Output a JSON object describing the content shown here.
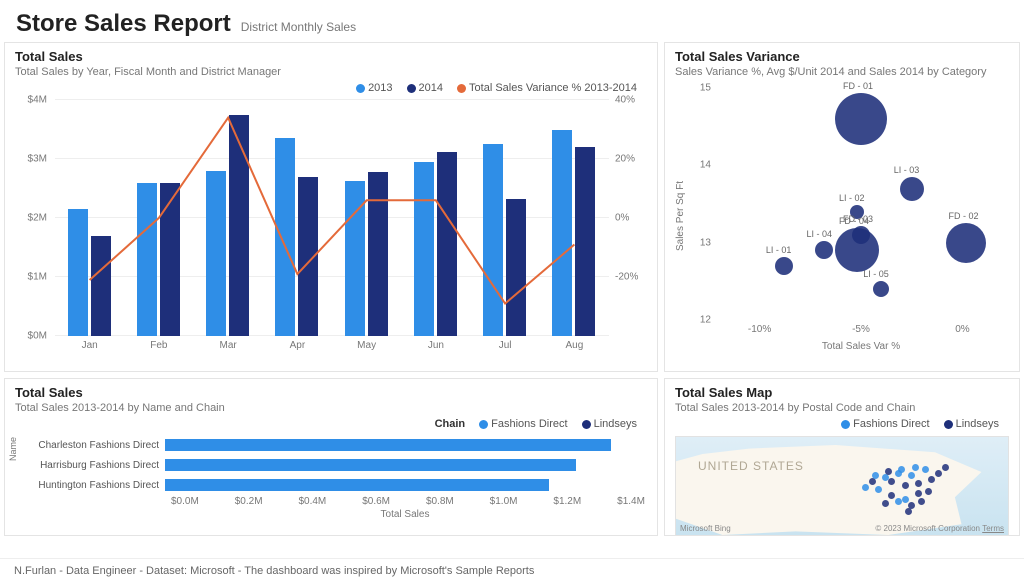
{
  "colors": {
    "blue": "#2f8ee7",
    "navy": "#1e2f7a",
    "orange": "#e46a3a"
  },
  "header": {
    "title": "Store Sales Report",
    "subtitle": "District Monthly Sales"
  },
  "footer": "N.Furlan - Data Engineer - Dataset: Microsoft - The dashboard was inspired by Microsoft's Sample Reports",
  "combo": {
    "title": "Total Sales",
    "subtitle": "Total Sales by Year, Fiscal Month and District Manager",
    "legend": {
      "s1": "2013",
      "s2": "2014",
      "s3": "Total Sales Variance % 2013-2014"
    }
  },
  "variance": {
    "title": "Total Sales Variance",
    "subtitle": "Sales Variance %, Avg $/Unit 2014 and Sales 2014 by Category",
    "ylabel": "Sales Per Sq Ft",
    "xlabel": "Total Sales Var %"
  },
  "hbar": {
    "title": "Total Sales",
    "subtitle": "Total Sales 2013-2014 by Name and Chain",
    "legend_label": "Chain",
    "legend": {
      "a": "Fashions Direct",
      "b": "Lindseys"
    },
    "ylabel": "Name",
    "xlabel": "Total Sales"
  },
  "mapcard": {
    "title": "Total Sales Map",
    "subtitle": "Total Sales 2013-2014 by Postal Code and Chain",
    "legend": {
      "a": "Fashions Direct",
      "b": "Lindseys"
    },
    "country": "UNITED STATES",
    "bing": "Microsoft Bing",
    "msc": "© 2023 Microsoft Corporation",
    "terms": "Terms"
  },
  "chart_data": [
    {
      "id": "combo",
      "type": "bar",
      "categories": [
        "Jan",
        "Feb",
        "Mar",
        "Apr",
        "May",
        "Jun",
        "Jul",
        "Aug"
      ],
      "series": [
        {
          "name": "2013",
          "values": [
            2150000,
            2600000,
            2800000,
            3350000,
            2620000,
            2950000,
            3250000,
            3500000
          ]
        },
        {
          "name": "2014",
          "values": [
            1700000,
            2600000,
            3750000,
            2700000,
            2780000,
            3120000,
            2320000,
            3200000
          ]
        }
      ],
      "line": {
        "name": "Total Sales Variance % 2013-2014",
        "values": [
          -21,
          0,
          34,
          -19,
          6,
          6,
          -29,
          -9
        ]
      },
      "ylimL": [
        0,
        4000000
      ],
      "ylimR": [
        -40,
        40
      ],
      "yticksL": [
        "$0M",
        "$1M",
        "$2M",
        "$3M",
        "$4M"
      ],
      "yticksR": [
        "-20%",
        "0%",
        "20%",
        "40%"
      ]
    },
    {
      "id": "variance",
      "type": "scatter",
      "xlabel": "Total Sales Var %",
      "ylabel": "Sales Per Sq Ft",
      "xlim": [
        -12,
        2
      ],
      "ylim": [
        12,
        15
      ],
      "xticks": [
        "-10%",
        "-5%",
        "0%"
      ],
      "yticks": [
        "12",
        "13",
        "14",
        "15"
      ],
      "points": [
        {
          "name": "FD - 01",
          "x": -5.0,
          "y": 14.6,
          "size": 52
        },
        {
          "name": "LI - 03",
          "x": -2.5,
          "y": 13.7,
          "size": 24
        },
        {
          "name": "FD - 02",
          "x": 0.2,
          "y": 13.0,
          "size": 40
        },
        {
          "name": "LI - 02",
          "x": -5.2,
          "y": 13.4,
          "size": 14
        },
        {
          "name": "FD - 03",
          "x": -5.0,
          "y": 13.1,
          "size": 18
        },
        {
          "name": "FD - 04",
          "x": -5.2,
          "y": 12.9,
          "size": 44
        },
        {
          "name": "LI - 04",
          "x": -6.8,
          "y": 12.9,
          "size": 18
        },
        {
          "name": "LI - 01",
          "x": -8.8,
          "y": 12.7,
          "size": 18
        },
        {
          "name": "LI - 05",
          "x": -4.0,
          "y": 12.4,
          "size": 16
        }
      ]
    },
    {
      "id": "hbar",
      "type": "bar",
      "xlim": [
        0,
        1400000
      ],
      "xticks": [
        "$0.0M",
        "$0.2M",
        "$0.4M",
        "$0.6M",
        "$0.8M",
        "$1.0M",
        "$1.2M",
        "$1.4M"
      ],
      "rows": [
        {
          "name": "Charleston Fashions Direct",
          "chain": "Fashions Direct",
          "value": 1300000
        },
        {
          "name": "Harrisburg Fashions Direct",
          "chain": "Fashions Direct",
          "value": 1200000
        },
        {
          "name": "Huntington Fashions Direct",
          "chain": "Fashions Direct",
          "value": 1120000
        }
      ]
    },
    {
      "id": "map",
      "type": "scatter",
      "points": [
        {
          "x": 62,
          "y": 38,
          "c": "a"
        },
        {
          "x": 64,
          "y": 42,
          "c": "b"
        },
        {
          "x": 66,
          "y": 34,
          "c": "a"
        },
        {
          "x": 68,
          "y": 46,
          "c": "b"
        },
        {
          "x": 70,
          "y": 36,
          "c": "a"
        },
        {
          "x": 72,
          "y": 44,
          "c": "b"
        },
        {
          "x": 74,
          "y": 30,
          "c": "a"
        },
        {
          "x": 76,
          "y": 40,
          "c": "b"
        },
        {
          "x": 78,
          "y": 34,
          "c": "b"
        },
        {
          "x": 72,
          "y": 54,
          "c": "b"
        },
        {
          "x": 68,
          "y": 60,
          "c": "a"
        },
        {
          "x": 70,
          "y": 66,
          "c": "b"
        },
        {
          "x": 60,
          "y": 50,
          "c": "a"
        },
        {
          "x": 58,
          "y": 42,
          "c": "b"
        },
        {
          "x": 56,
          "y": 48,
          "c": "a"
        },
        {
          "x": 64,
          "y": 56,
          "c": "b"
        },
        {
          "x": 66,
          "y": 62,
          "c": "a"
        },
        {
          "x": 62,
          "y": 64,
          "c": "b"
        },
        {
          "x": 75,
          "y": 52,
          "c": "b"
        },
        {
          "x": 80,
          "y": 28,
          "c": "b"
        },
        {
          "x": 71,
          "y": 28,
          "c": "a"
        },
        {
          "x": 67,
          "y": 30,
          "c": "a"
        },
        {
          "x": 63,
          "y": 32,
          "c": "b"
        },
        {
          "x": 59,
          "y": 36,
          "c": "a"
        },
        {
          "x": 73,
          "y": 62,
          "c": "b"
        },
        {
          "x": 69,
          "y": 72,
          "c": "b"
        }
      ]
    }
  ]
}
